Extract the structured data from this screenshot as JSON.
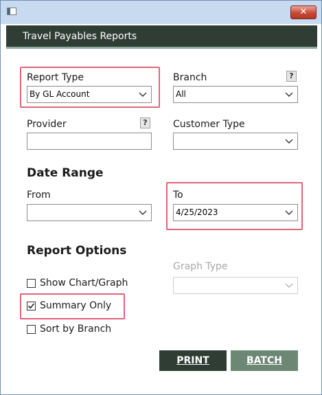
{
  "window": {
    "close_glyph": "✕"
  },
  "header": {
    "title": "Travel Payables Reports"
  },
  "form": {
    "report_type": {
      "label": "Report Type",
      "value": "By GL Account"
    },
    "branch": {
      "label": "Branch",
      "value": "All",
      "help": "?"
    },
    "provider": {
      "label": "Provider",
      "value": "",
      "help": "?"
    },
    "customer_type": {
      "label": "Customer Type",
      "value": ""
    },
    "date_range": {
      "heading": "Date Range",
      "from": {
        "label": "From",
        "value": ""
      },
      "to": {
        "label": "To",
        "value": "4/25/2023"
      }
    },
    "report_options": {
      "heading": "Report Options",
      "show_chart": {
        "label": "Show Chart/Graph",
        "checked": false
      },
      "summary_only": {
        "label": "Summary Only",
        "checked": true
      },
      "sort_by_branch": {
        "label": "Sort by Branch",
        "checked": false
      },
      "graph_type": {
        "label": "Graph Type",
        "value": "",
        "enabled": false
      }
    }
  },
  "buttons": {
    "print": "PRINT",
    "batch": "BATCH"
  },
  "colors": {
    "header_bg": "#2f3d35",
    "print_bg": "#2f3d35",
    "batch_bg": "#6d8775",
    "highlight": "#e0637a",
    "titlebar": "#c7daf0"
  }
}
